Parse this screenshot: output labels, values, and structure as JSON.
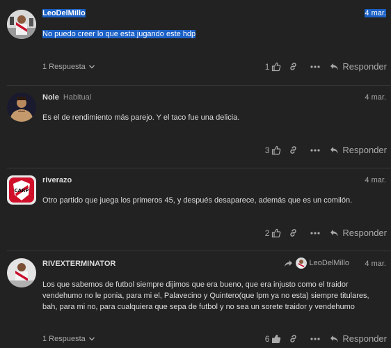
{
  "posts": [
    {
      "username": "LeoDelMillo",
      "date": "4 mar.",
      "body": "No puedo creer lo que esta jugando este hdp",
      "replies": "1 Respuesta",
      "likes": "1",
      "reply_label": "Responder"
    },
    {
      "username": "Nole",
      "flair": "Habitual",
      "date": "4 mar.",
      "body": "Es el de rendimiento más parejo. Y el taco fue una delicia.",
      "likes": "3",
      "reply_label": "Responder"
    },
    {
      "username": "riverazo",
      "date": "4 mar.",
      "body": "Otro partido que juega los primeros 45, y después desaparece, además que es un comilón.",
      "likes": "2",
      "reply_label": "Responder"
    },
    {
      "username": "RIVEXTERMINATOR",
      "date": "4 mar.",
      "reply_to": "LeoDelMillo",
      "body": "Los que sabemos de futbol siempre dijimos que era bueno, que era injusto como el traidor vendehumo no le ponia, para mi el, Palavecino y Quintero(que lpm ya no esta) siempre titulares, bah, para mi no, para cualquiera que sepa de futbol y no sea un sorete traidor y vendehumo",
      "replies": "1 Respuesta",
      "likes": "6",
      "reply_label": "Responder"
    }
  ],
  "icons": {
    "like": "heart-thumb-icon",
    "link": "link-icon",
    "more": "ellipsis-icon",
    "reply": "reply-arrow-icon",
    "chevron": "chevron-down-icon",
    "reply_to": "share-arrow-icon"
  },
  "colors": {
    "background": "#222222",
    "text": "#dddddd",
    "muted": "#aaaaaa",
    "selection": "#1a5fc5",
    "divider": "#3a3a3a"
  }
}
